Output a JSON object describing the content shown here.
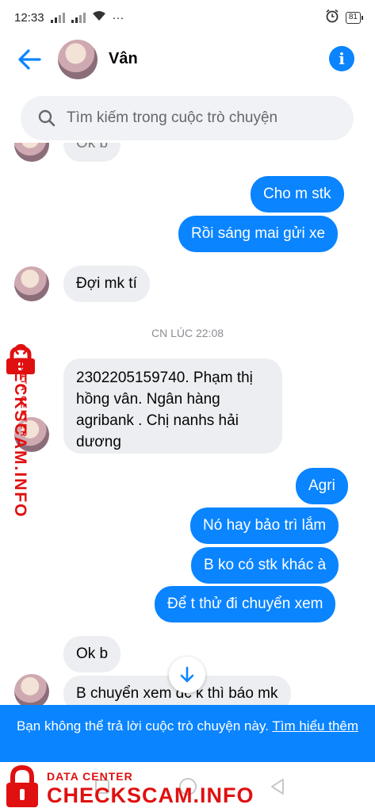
{
  "status_bar": {
    "time": "12:33",
    "dots": "···",
    "battery": "81"
  },
  "header": {
    "contact_name": "Vân"
  },
  "search": {
    "placeholder": "Tìm kiếm trong cuộc trò chuyện"
  },
  "messages": [
    {
      "id": "m0",
      "direction": "incoming",
      "text": "Ok b"
    },
    {
      "id": "m1",
      "direction": "outgoing",
      "text": "Cho m stk"
    },
    {
      "id": "m2",
      "direction": "outgoing",
      "text": "Rồi sáng mai gửi xe"
    },
    {
      "id": "m3",
      "direction": "incoming",
      "text": "Đợi mk tí"
    },
    {
      "id": "m4",
      "direction": "incoming",
      "text": "2302205159740. Phạm thị hồng vân. Ngân hàng agribank . Chị nanhs hải dương"
    },
    {
      "id": "m5",
      "direction": "outgoing",
      "text": "Agri"
    },
    {
      "id": "m6",
      "direction": "outgoing",
      "text": "Nó hay bảo trì lắm"
    },
    {
      "id": "m7",
      "direction": "outgoing",
      "text": "B ko có stk khác à"
    },
    {
      "id": "m8",
      "direction": "outgoing",
      "text": "Để t thử đi chuyển xem"
    },
    {
      "id": "m9",
      "direction": "incoming",
      "text": "Ok b"
    },
    {
      "id": "m10",
      "direction": "incoming",
      "text": "B chuyển xem dc k thì báo mk"
    }
  ],
  "timestamp": "CN LÚC 22:08",
  "banner": {
    "text": "Bạn không thể trả lời cuộc trò chuyện này.",
    "link": "Tìm hiểu thêm"
  },
  "watermark": {
    "label": "DATA CENTER",
    "site": "CHECKSCAM.INFO"
  },
  "colors": {
    "accent": "#0a84ff",
    "incoming_bubble": "#eceef1",
    "watermark": "#e01010"
  }
}
